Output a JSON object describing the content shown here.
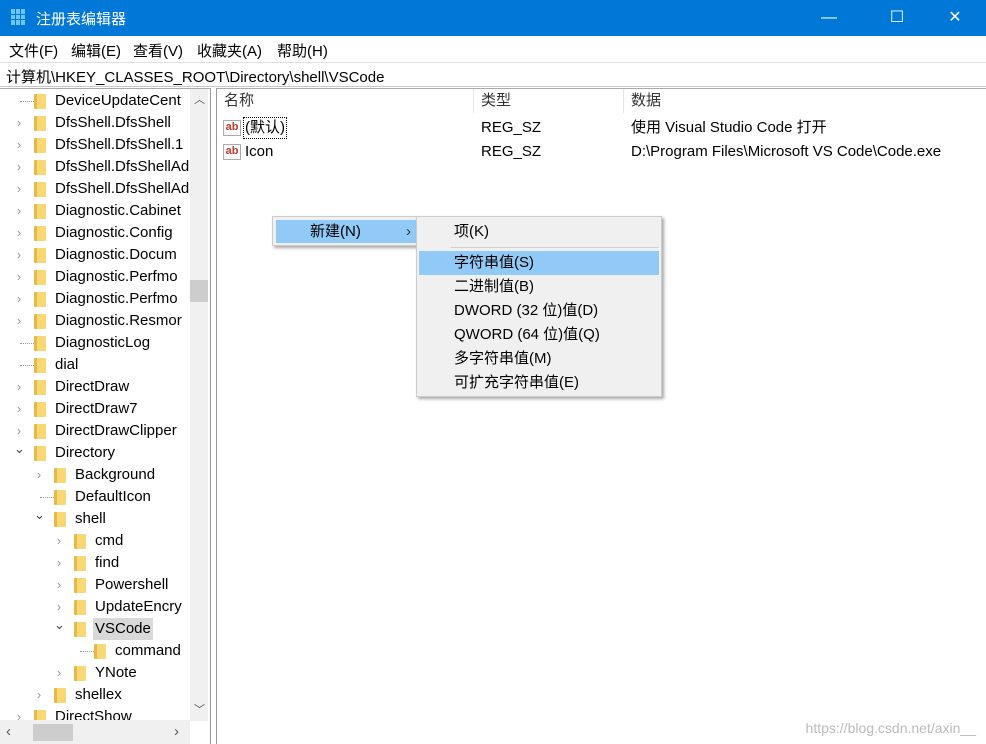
{
  "window": {
    "title": "注册表编辑器",
    "minimize": "—",
    "maximize": "☐",
    "close": "✕"
  },
  "menu": [
    "文件(F)",
    "编辑(E)",
    "查看(V)",
    "收藏夹(A)",
    "帮助(H)"
  ],
  "address": "计算机\\HKEY_CLASSES_ROOT\\Directory\\shell\\VSCode",
  "tree": [
    {
      "label": "DeviceUpdateCent",
      "level": 0,
      "state": "leaf"
    },
    {
      "label": "DfsShell.DfsShell",
      "level": 0,
      "state": "collapsed"
    },
    {
      "label": "DfsShell.DfsShell.1",
      "level": 0,
      "state": "collapsed"
    },
    {
      "label": "DfsShell.DfsShellAd",
      "level": 0,
      "state": "collapsed"
    },
    {
      "label": "DfsShell.DfsShellAd",
      "level": 0,
      "state": "collapsed"
    },
    {
      "label": "Diagnostic.Cabinet",
      "level": 0,
      "state": "collapsed"
    },
    {
      "label": "Diagnostic.Config",
      "level": 0,
      "state": "collapsed"
    },
    {
      "label": "Diagnostic.Docum",
      "level": 0,
      "state": "collapsed"
    },
    {
      "label": "Diagnostic.Perfmo",
      "level": 0,
      "state": "collapsed"
    },
    {
      "label": "Diagnostic.Perfmo",
      "level": 0,
      "state": "collapsed"
    },
    {
      "label": "Diagnostic.Resmor",
      "level": 0,
      "state": "collapsed"
    },
    {
      "label": "DiagnosticLog",
      "level": 0,
      "state": "leaf"
    },
    {
      "label": "dial",
      "level": 0,
      "state": "leaf"
    },
    {
      "label": "DirectDraw",
      "level": 0,
      "state": "collapsed"
    },
    {
      "label": "DirectDraw7",
      "level": 0,
      "state": "collapsed"
    },
    {
      "label": "DirectDrawClipper",
      "level": 0,
      "state": "collapsed"
    },
    {
      "label": "Directory",
      "level": 0,
      "state": "expanded"
    },
    {
      "label": "Background",
      "level": 1,
      "state": "collapsed"
    },
    {
      "label": "DefaultIcon",
      "level": 1,
      "state": "leaf"
    },
    {
      "label": "shell",
      "level": 1,
      "state": "expanded"
    },
    {
      "label": "cmd",
      "level": 2,
      "state": "collapsed"
    },
    {
      "label": "find",
      "level": 2,
      "state": "collapsed"
    },
    {
      "label": "Powershell",
      "level": 2,
      "state": "collapsed"
    },
    {
      "label": "UpdateEncry",
      "level": 2,
      "state": "collapsed"
    },
    {
      "label": "VSCode",
      "level": 2,
      "state": "expanded",
      "selected": true
    },
    {
      "label": "command",
      "level": 3,
      "state": "leaf"
    },
    {
      "label": "YNote",
      "level": 2,
      "state": "collapsed"
    },
    {
      "label": "shellex",
      "level": 1,
      "state": "collapsed"
    },
    {
      "label": "DirectShow",
      "level": 0,
      "state": "collapsed"
    }
  ],
  "columns": [
    "名称",
    "类型",
    "数据"
  ],
  "values": [
    {
      "name": "(默认)",
      "type": "REG_SZ",
      "data": "使用 Visual Studio Code 打开"
    },
    {
      "name": "Icon",
      "type": "REG_SZ",
      "data": "D:\\Program Files\\Microsoft VS Code\\Code.exe"
    }
  ],
  "context_menu": {
    "new": "新建(N)",
    "arrow": "›"
  },
  "submenu": [
    "项(K)",
    "字符串值(S)",
    "二进制值(B)",
    "DWORD (32 位)值(D)",
    "QWORD (64 位)值(Q)",
    "多字符串值(M)",
    "可扩充字符串值(E)"
  ],
  "highlight_color": "#91c9f7",
  "watermark": "https://blog.csdn.net/axin__"
}
